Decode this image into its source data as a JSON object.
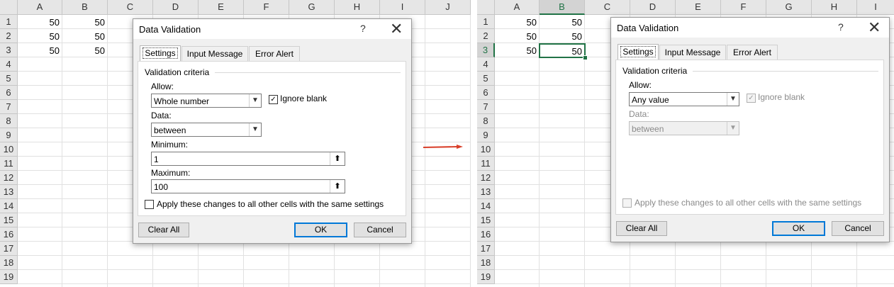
{
  "left": {
    "columns": [
      "A",
      "B",
      "C",
      "D",
      "E",
      "F",
      "G",
      "H",
      "I",
      "J"
    ],
    "rows": [
      "1",
      "2",
      "3",
      "4",
      "5",
      "6",
      "7",
      "8",
      "9",
      "10",
      "11",
      "12",
      "13",
      "14",
      "15",
      "16",
      "17",
      "18",
      "19"
    ],
    "cells": [
      [
        "50",
        "50"
      ],
      [
        "50",
        "50"
      ],
      [
        "50",
        "50"
      ]
    ],
    "dialog": {
      "title": "Data Validation",
      "help": "?",
      "close": "✕",
      "tabs": [
        "Settings",
        "Input Message",
        "Error Alert"
      ],
      "criteria_legend": "Validation criteria",
      "allow_label": "Allow:",
      "allow_value": "Whole number",
      "ignore_blank_label": "Ignore blank",
      "ignore_blank_checked": true,
      "data_label": "Data:",
      "data_value": "between",
      "minimum_label": "Minimum:",
      "minimum_value": "1",
      "maximum_label": "Maximum:",
      "maximum_value": "100",
      "apply_label": "Apply these changes to all other cells with the same settings",
      "clear_all": "Clear All",
      "ok": "OK",
      "cancel": "Cancel"
    }
  },
  "right": {
    "columns": [
      "A",
      "B",
      "C",
      "D",
      "E",
      "F",
      "G",
      "H",
      "I"
    ],
    "rows": [
      "1",
      "2",
      "3",
      "4",
      "5",
      "6",
      "7",
      "8",
      "9",
      "10",
      "11",
      "12",
      "13",
      "14",
      "15",
      "16",
      "17",
      "18",
      "19"
    ],
    "selected_column": "B",
    "selected_row": "3",
    "cells": [
      [
        "50",
        "50"
      ],
      [
        "50",
        "50"
      ],
      [
        "50",
        "50"
      ]
    ],
    "dialog": {
      "title": "Data Validation",
      "help": "?",
      "close": "✕",
      "tabs": [
        "Settings",
        "Input Message",
        "Error Alert"
      ],
      "criteria_legend": "Validation criteria",
      "allow_label": "Allow:",
      "allow_value": "Any value",
      "ignore_blank_label": "Ignore blank",
      "ignore_blank_checked": true,
      "data_label": "Data:",
      "data_value": "between",
      "apply_label": "Apply these changes to all other cells with the same settings",
      "clear_all": "Clear All",
      "ok": "OK",
      "cancel": "Cancel"
    }
  },
  "colors": {
    "accent_green": "#217346",
    "arrow_red": "#d9402b",
    "focus_blue": "#0078d7"
  },
  "icons": {
    "range_selector": "⬆",
    "dropdown": "▼",
    "check": "✓"
  }
}
